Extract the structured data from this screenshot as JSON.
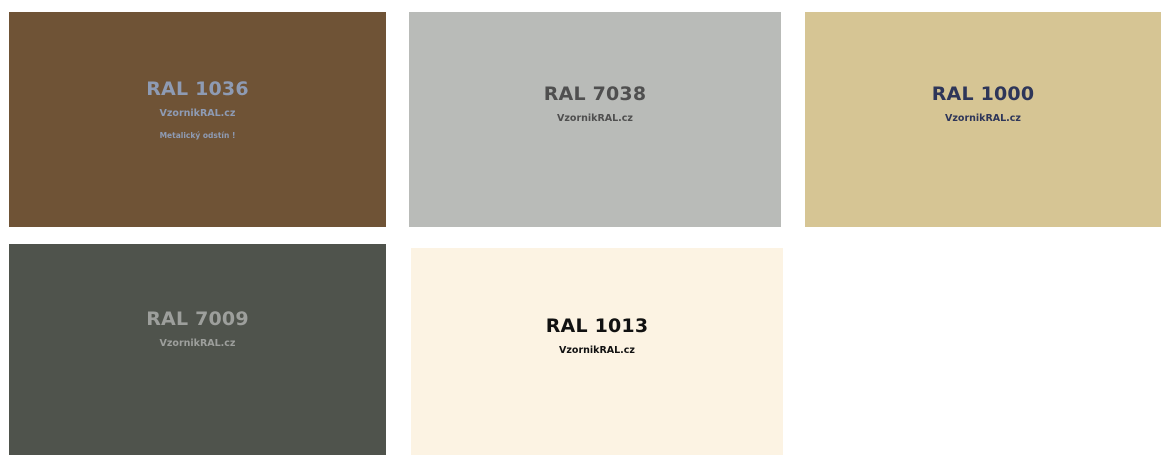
{
  "swatches": [
    {
      "code": "RAL 1036",
      "site": "VzornikRAL.cz",
      "note": "Metalický odstín !",
      "background": "#6f5336",
      "text_color": "#8e9bb4"
    },
    {
      "code": "RAL 7038",
      "site": "VzornikRAL.cz",
      "background": "#b9bbb8",
      "text_color": "#4f4f4f"
    },
    {
      "code": "RAL 1000",
      "site": "VzornikRAL.cz",
      "background": "#d6c594",
      "text_color": "#2e3659"
    },
    {
      "code": "RAL 7009",
      "site": "VzornikRAL.cz",
      "background": "#4f534c",
      "text_color": "#9d9f9c"
    },
    {
      "code": "RAL 1013",
      "site": "VzornikRAL.cz",
      "background": "#fcf3e3",
      "text_color": "#111111"
    }
  ]
}
